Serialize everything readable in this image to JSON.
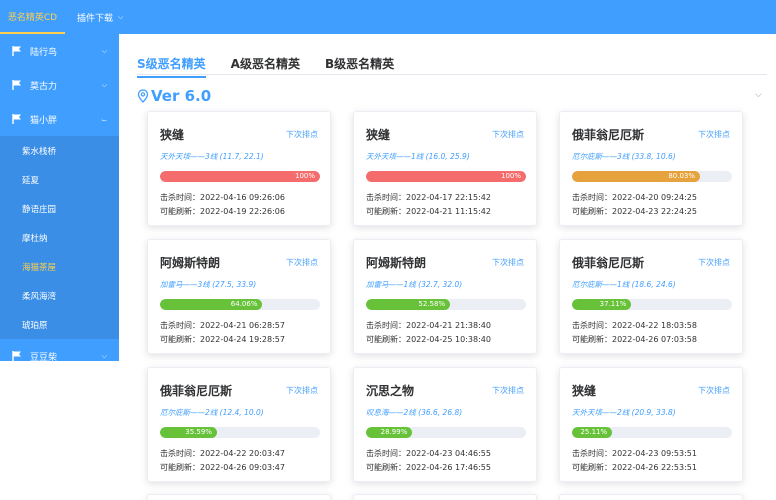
{
  "topbar": {
    "brand": "恶名精英CD",
    "menu_label": "插件下载"
  },
  "sidebar": {
    "groups": [
      {
        "label": "陆行鸟",
        "expanded": false
      },
      {
        "label": "莫古力",
        "expanded": false
      },
      {
        "label": "猫小胖",
        "expanded": true
      },
      {
        "label": "豆豆柴",
        "expanded": false
      }
    ],
    "subitems": [
      "紫水栈桥",
      "延夏",
      "静语庄园",
      "摩杜纳",
      "海猫茶屋",
      "柔风海湾",
      "琥珀原"
    ],
    "active_subitem": "海猫茶屋"
  },
  "tabs": [
    "S级恶名精英",
    "A级恶名精英",
    "B级恶名精英"
  ],
  "active_tab": "S级恶名精英",
  "section": {
    "title": "Ver 6.0"
  },
  "cards": [
    {
      "name": "狭缝",
      "next": "下次排点",
      "loc": "天外天垓——3线 (11.7, 22.1)",
      "pct": "100%",
      "value": 100,
      "color": "#f56c6c",
      "kill": "击杀时间：2022-04-16 09:26:06",
      "refresh": "可能刷新：2022-04-19 22:26:06"
    },
    {
      "name": "狭缝",
      "next": "下次排点",
      "loc": "天外天垓——1线 (16.0, 25.9)",
      "pct": "100%",
      "value": 100,
      "color": "#f56c6c",
      "kill": "击杀时间：2022-04-17 22:15:42",
      "refresh": "可能刷新：2022-04-21 11:15:42"
    },
    {
      "name": "俄菲翁尼厄斯",
      "next": "下次排点",
      "loc": "厄尔庇斯——3线 (33.8, 10.6)",
      "pct": "80.03%",
      "value": 80.03,
      "color": "#e6a23c",
      "kill": "击杀时间：2022-04-20 09:24:25",
      "refresh": "可能刷新：2022-04-23 22:24:25"
    },
    {
      "name": "阿姆斯特朗",
      "next": "下次排点",
      "loc": "加雷马——3线 (27.5, 33.9)",
      "pct": "64.06%",
      "value": 64.06,
      "color": "#67c23a",
      "kill": "击杀时间：2022-04-21 06:28:57",
      "refresh": "可能刷新：2022-04-24 19:28:57"
    },
    {
      "name": "阿姆斯特朗",
      "next": "下次排点",
      "loc": "加雷马——1线 (32.7, 32.0)",
      "pct": "52.58%",
      "value": 52.58,
      "color": "#67c23a",
      "kill": "击杀时间：2022-04-21 21:38:40",
      "refresh": "可能刷新：2022-04-25 10:38:40"
    },
    {
      "name": "俄菲翁尼厄斯",
      "next": "下次排点",
      "loc": "厄尔庇斯——1线 (18.6, 24.6)",
      "pct": "37.11%",
      "value": 37.11,
      "color": "#67c23a",
      "kill": "击杀时间：2022-04-22 18:03:58",
      "refresh": "可能刷新：2022-04-26 07:03:58"
    },
    {
      "name": "俄菲翁尼厄斯",
      "next": "下次排点",
      "loc": "厄尔庇斯——2线 (12.4, 10.0)",
      "pct": "35.59%",
      "value": 35.59,
      "color": "#67c23a",
      "kill": "击杀时间：2022-04-22 20:03:47",
      "refresh": "可能刷新：2022-04-26 09:03:47"
    },
    {
      "name": "沉思之物",
      "next": "下次排点",
      "loc": "叹息海——2线 (36.6, 26.8)",
      "pct": "28.99%",
      "value": 28.99,
      "color": "#67c23a",
      "kill": "击杀时间：2022-04-23 04:46:55",
      "refresh": "可能刷新：2022-04-26 17:46:55"
    },
    {
      "name": "狭缝",
      "next": "下次排点",
      "loc": "天外天垓——2线 (20.9, 33.8)",
      "pct": "25.11%",
      "value": 25.11,
      "color": "#67c23a",
      "kill": "击杀时间：2022-04-23 09:53:51",
      "refresh": "可能刷新：2022-04-26 22:53:51"
    }
  ]
}
